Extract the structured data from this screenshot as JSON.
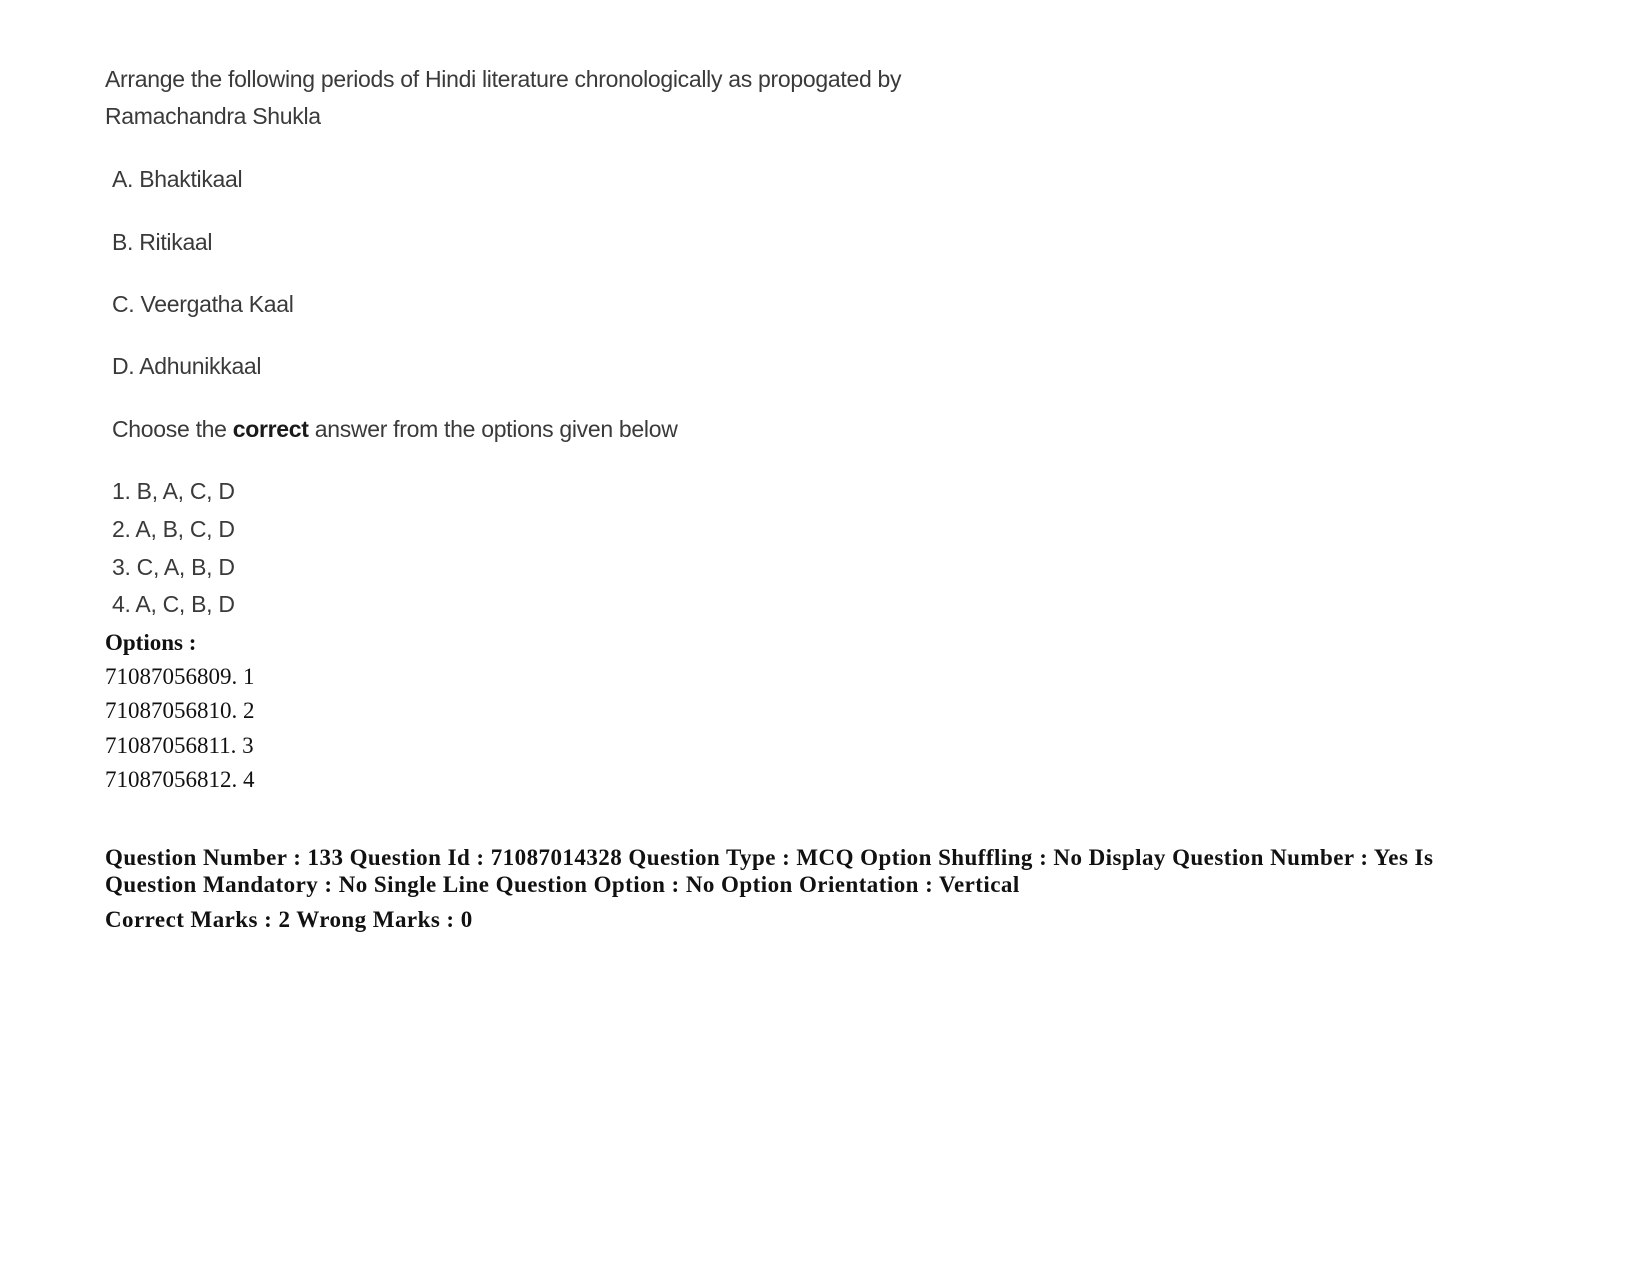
{
  "question": {
    "stem_line1": "Arrange the following periods of Hindi literature chronologically as propogated by",
    "stem_line2": "Ramachandra Shukla",
    "items": [
      "A. Bhaktikaal",
      "B. Ritikaal",
      "C. Veergatha Kaal",
      "D. Adhunikkaal"
    ],
    "instruction_pre": "Choose the ",
    "instruction_bold": "correct",
    "instruction_post": " answer from the options given below",
    "choices": [
      "1. B, A, C, D",
      "2. A, B, C, D",
      "3. C, A, B, D",
      "4. A, C, B, D"
    ]
  },
  "options": {
    "heading": "Options :",
    "list": [
      "71087056809. 1",
      "71087056810. 2",
      "71087056811. 3",
      "71087056812. 4"
    ]
  },
  "metadata": {
    "line1": "Question Number : 133 Question Id : 71087014328 Question Type : MCQ Option Shuffling : No Display Question Number : Yes Is",
    "line2": "Question Mandatory : No Single Line Question Option : No Option Orientation : Vertical",
    "line3": "Correct Marks : 2 Wrong Marks : 0"
  }
}
